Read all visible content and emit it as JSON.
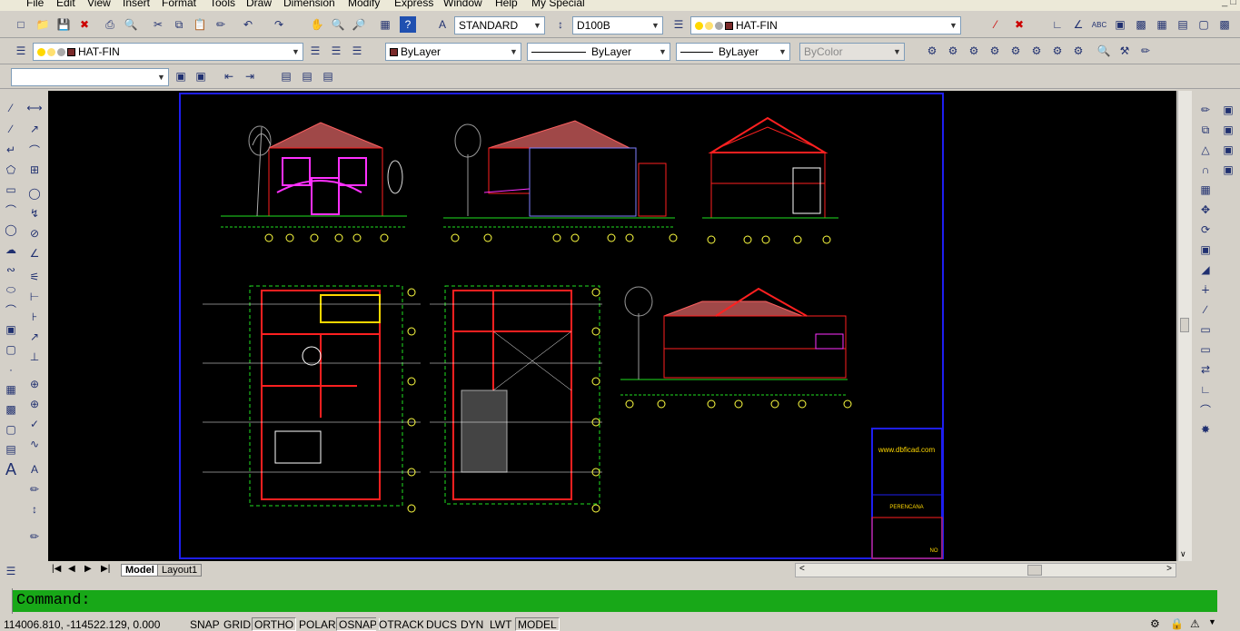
{
  "menu": [
    "File",
    "Edit",
    "View",
    "Insert",
    "Format",
    "Tools",
    "Draw",
    "Dimension",
    "Modify",
    "Express",
    "Window",
    "Help",
    "My Special"
  ],
  "toolbar1": {
    "text_style": "STANDARD",
    "dim_style": "D100B",
    "layer": "HAT-FIN"
  },
  "toolbar2": {
    "layer": "HAT-FIN",
    "color": "ByLayer",
    "linetype": "ByLayer",
    "lineweight": "ByLayer",
    "plotstyle": "ByColor"
  },
  "toolbar3": {
    "view_combo": ""
  },
  "drawing": {
    "watermark": "www.dbficad.com",
    "title_label": "PERENCANA",
    "sheet_no": "NO"
  },
  "tabs": [
    "Model",
    "Layout1"
  ],
  "command": {
    "prompt": "Command:"
  },
  "status": {
    "coords": "114006.810, -114522.129, 0.000",
    "buttons": [
      "SNAP",
      "GRID",
      "ORTHO",
      "POLAR",
      "OSNAP",
      "OTRACK",
      "DUCS",
      "DYN",
      "LWT",
      "MODEL"
    ],
    "pressed": [
      "ORTHO",
      "OSNAP",
      "MODEL"
    ]
  },
  "colors": {
    "canvas": "#000000",
    "command_bg": "#18a818",
    "sheet_border": "#1e1ef0",
    "wall": "#ff2020",
    "dim": "#20e020",
    "roof": "#a04848",
    "accent": "#ff30ff"
  }
}
